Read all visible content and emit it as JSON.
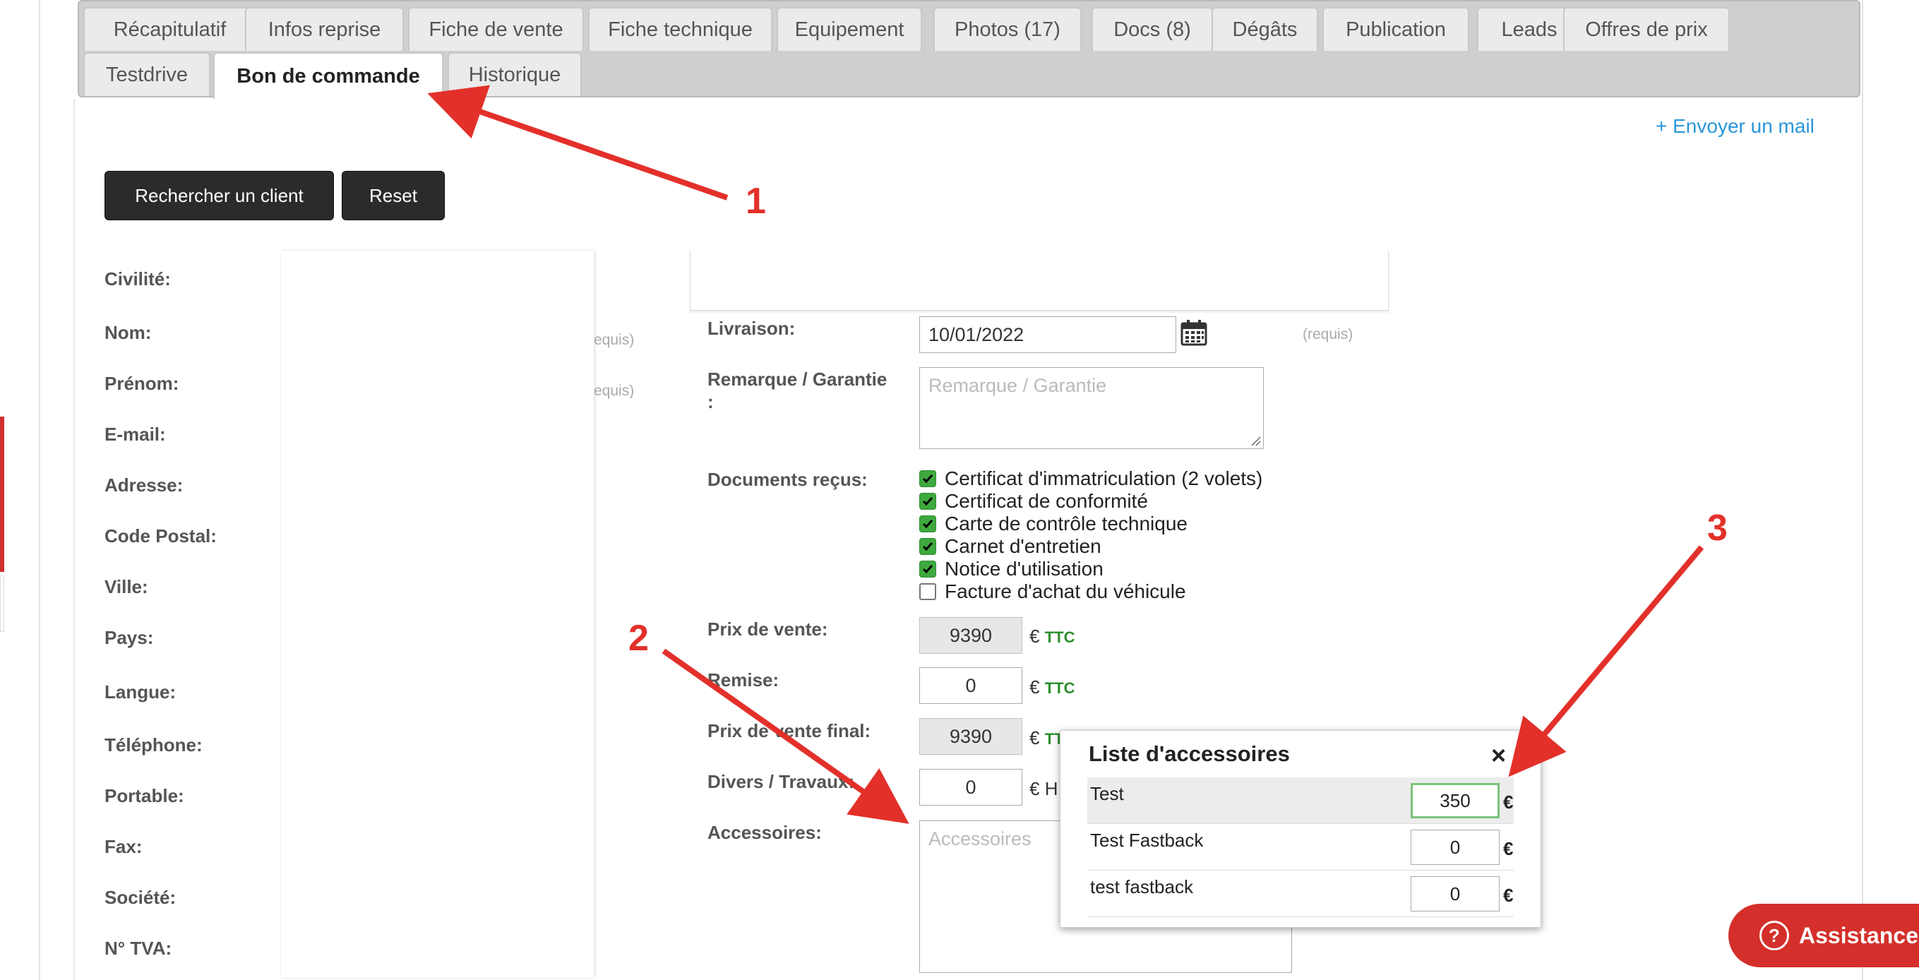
{
  "tabs": {
    "row1": [
      "Récapitulatif",
      "Infos reprise",
      "Fiche de vente",
      "Fiche technique",
      "Equipement",
      "Photos (17)",
      "Docs (8)",
      "Dégâts",
      "Publication",
      "Leads",
      "Offres de prix"
    ],
    "row2": [
      "Testdrive",
      "Bon de commande",
      "Historique"
    ],
    "active": "Bon de commande"
  },
  "header": {
    "send_mail_link": "+ Envoyer un mail"
  },
  "actions": {
    "search_client": "Rechercher un client",
    "reset": "Reset"
  },
  "client_fields": [
    "Civilité:",
    "Nom:",
    "Prénom:",
    "E-mail:",
    "Adresse:",
    "Code Postal:",
    "Ville:",
    "Pays:",
    "Langue:",
    "Téléphone:",
    "Portable:",
    "Fax:",
    "Société:",
    "N° TVA:"
  ],
  "requis_partial": "equis)",
  "order": {
    "delivery_label": "Livraison:",
    "delivery_value": "10/01/2022",
    "delivery_requis": "(requis)",
    "remark_label": "Remarque / Garantie",
    "remark_label_colon": ":",
    "remark_placeholder": "Remarque / Garantie",
    "documents_label": "Documents reçus:",
    "documents": [
      {
        "label": "Certificat d'immatriculation (2 volets)",
        "checked": true
      },
      {
        "label": "Certificat de conformité",
        "checked": true
      },
      {
        "label": "Carte de contrôle technique",
        "checked": true
      },
      {
        "label": "Carnet d'entretien",
        "checked": true
      },
      {
        "label": "Notice d'utilisation",
        "checked": true
      },
      {
        "label": "Facture d'achat du véhicule",
        "checked": false
      }
    ],
    "sale_price_label": "Prix de vente:",
    "sale_price": "9390",
    "discount_label": "Remise:",
    "discount": "0",
    "final_price_label": "Prix de vente final:",
    "final_price": "9390",
    "misc_label": "Divers / Travaux:",
    "misc": "0",
    "accessories_label": "Accessoires:",
    "accessories_placeholder": "Accessoires",
    "currency": "€",
    "ttc": "TTC",
    "htva_partial": "H"
  },
  "accessory_popup": {
    "title": "Liste d'accessoires",
    "close": "×",
    "currency": "€",
    "items": [
      {
        "name": "Test",
        "value": "350"
      },
      {
        "name": "Test Fastback",
        "value": "0"
      },
      {
        "name": "test fastback",
        "value": "0"
      }
    ]
  },
  "assistance": {
    "icon": "?",
    "label": "Assistance"
  },
  "annotations": [
    "1",
    "2",
    "3"
  ],
  "colors": {
    "accent_link": "#2a96d8",
    "annotation": "#e3302a",
    "check_green": "#3ea93e",
    "assist_red": "#d42f2b"
  }
}
